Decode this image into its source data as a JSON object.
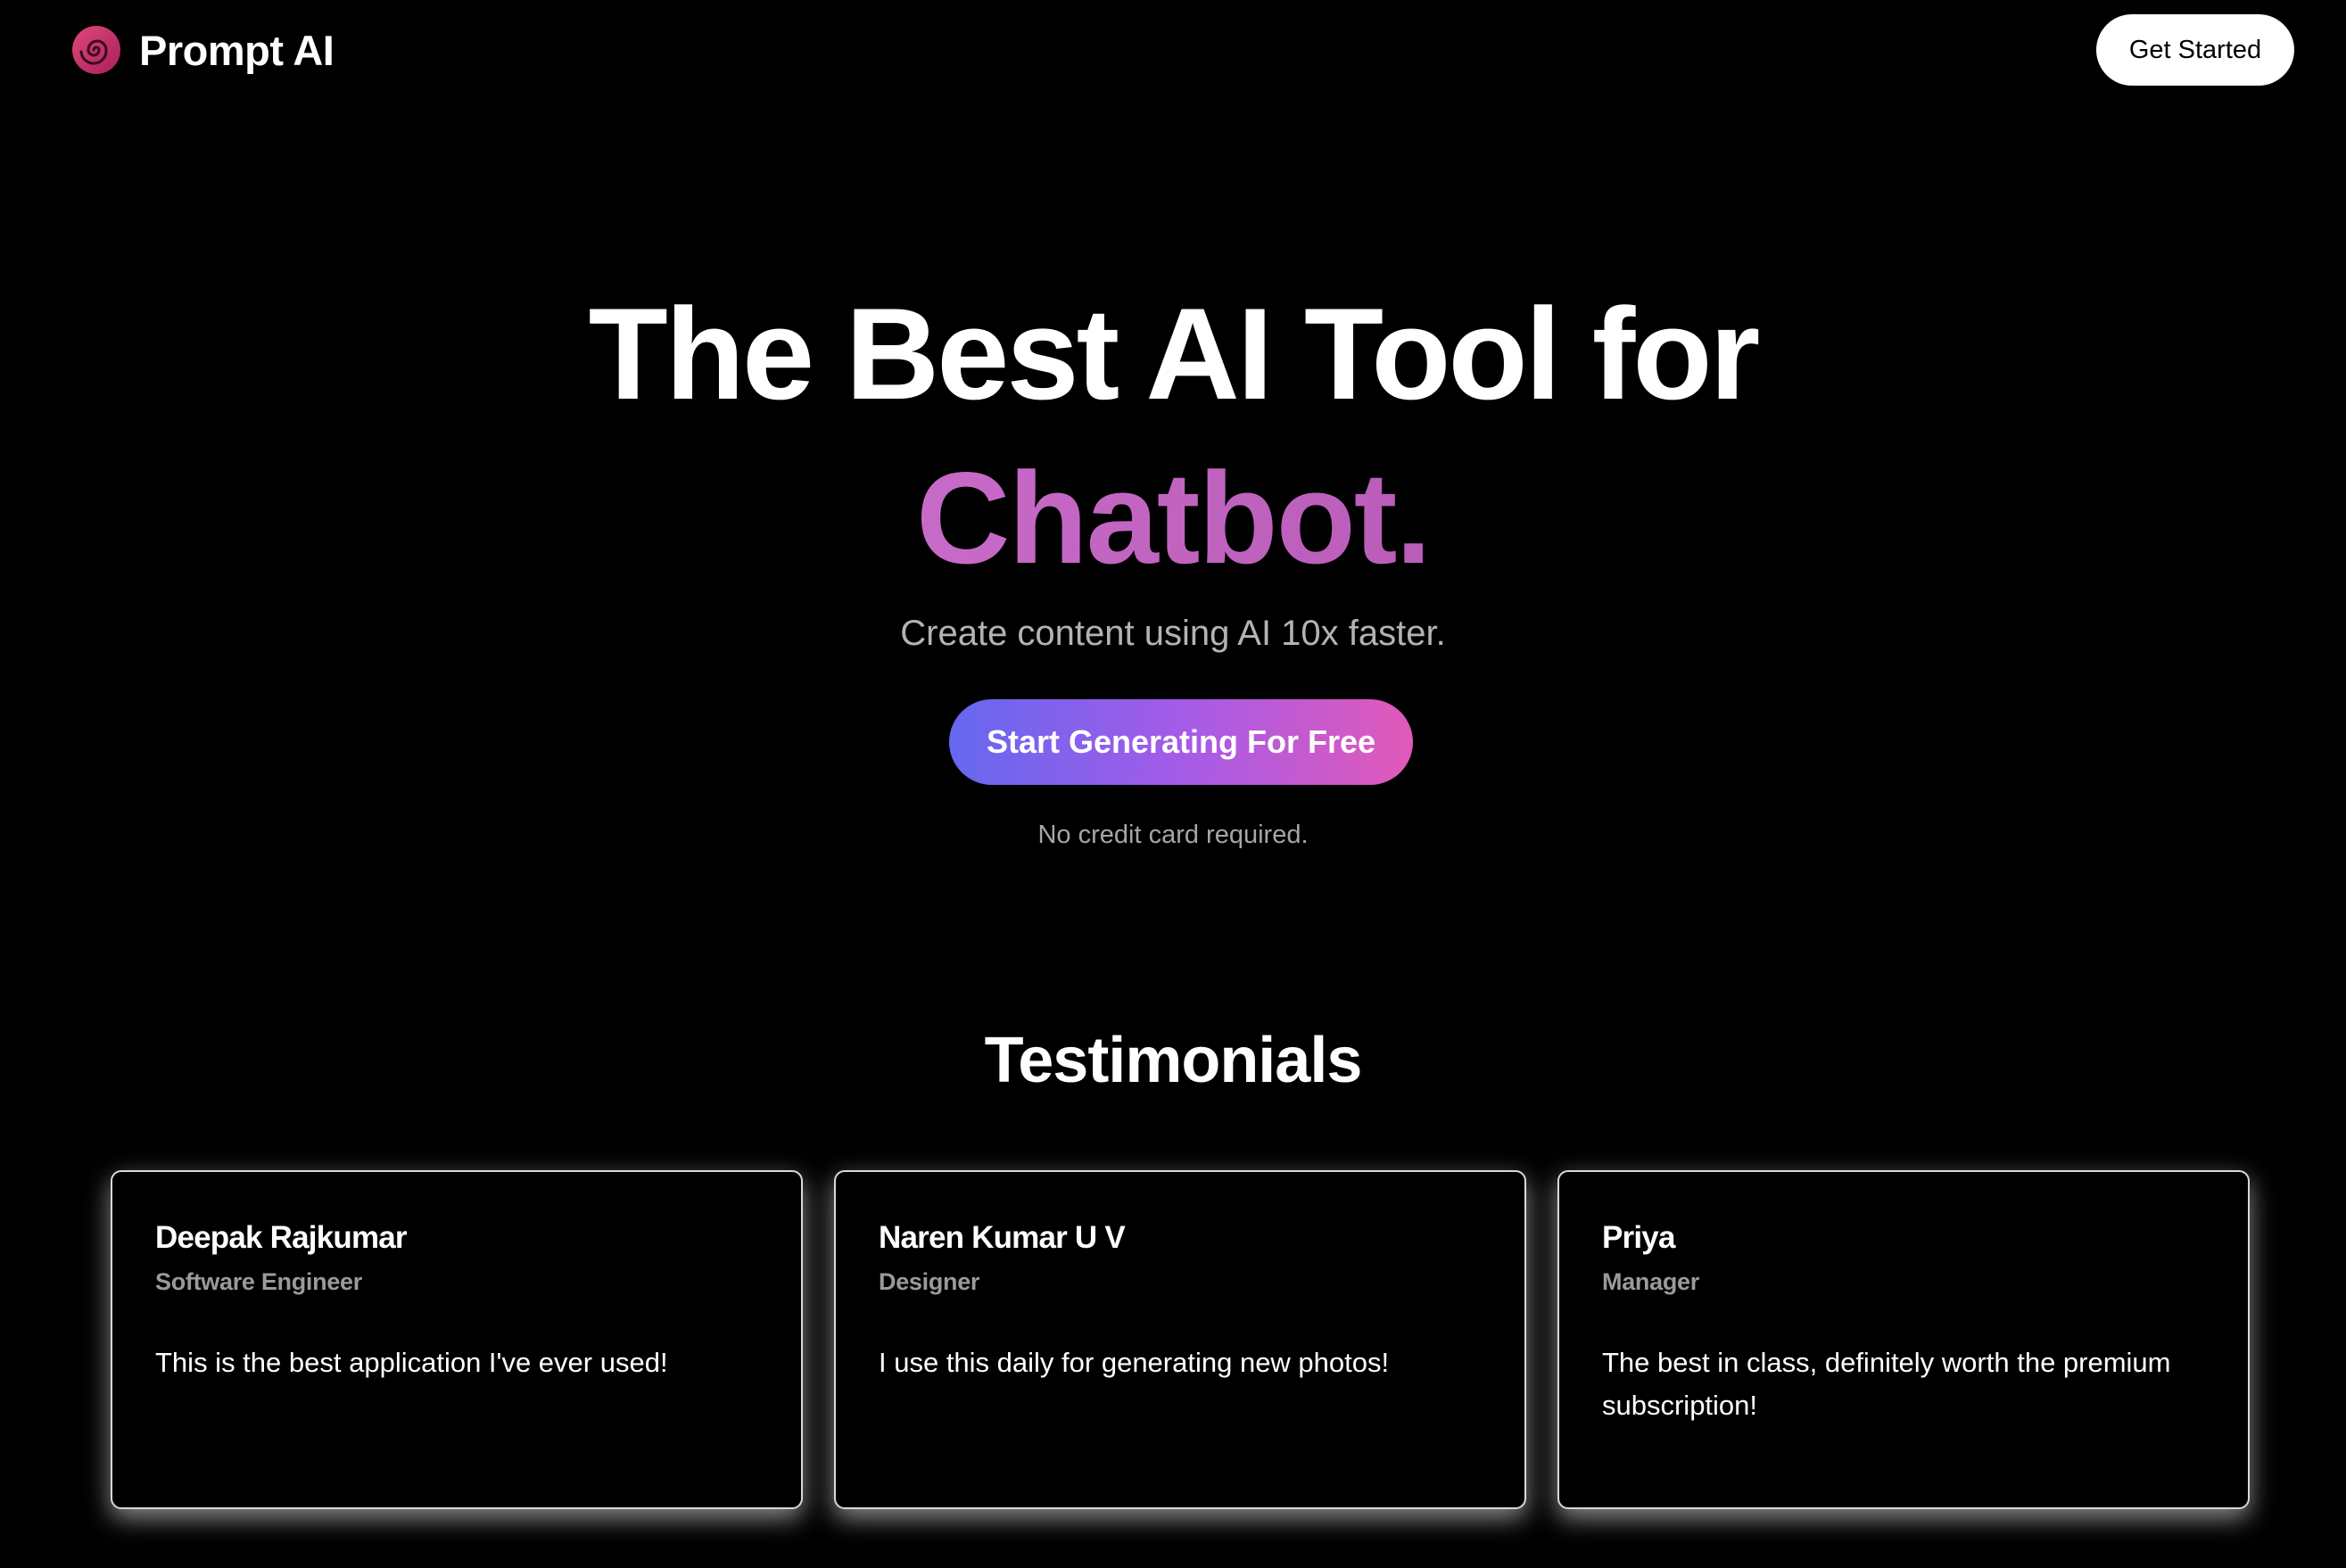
{
  "header": {
    "brand_name": "Prompt AI",
    "logo_icon": "spiral-icon",
    "get_started_label": "Get Started"
  },
  "hero": {
    "title_line1": "The Best AI Tool for",
    "title_accent": "Chatbot.",
    "subtitle": "Create content using AI 10x faster.",
    "cta_label": "Start Generating For Free",
    "note": "No credit card required."
  },
  "testimonials": {
    "title": "Testimonials",
    "items": [
      {
        "name": "Deepak Rajkumar",
        "role": "Software Engineer",
        "quote": "This is the best application I've ever used!"
      },
      {
        "name": "Naren Kumar U V",
        "role": "Designer",
        "quote": "I use this daily for generating new photos!"
      },
      {
        "name": "Priya",
        "role": "Manager",
        "quote": "The best in class, definitely worth the premium subscription!"
      }
    ]
  },
  "colors": {
    "background": "#000000",
    "accent_text": "#c361c4",
    "cta_gradient_start": "#6568f0",
    "cta_gradient_end": "#e15ab9",
    "logo": "#d43a6a"
  }
}
